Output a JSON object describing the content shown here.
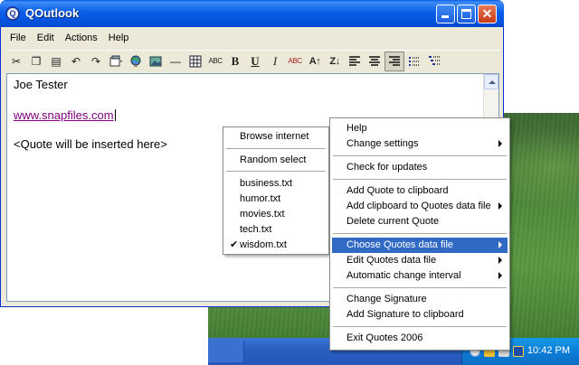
{
  "window": {
    "title": "QOutlook",
    "icon_glyph": "Q"
  },
  "menubar": [
    "File",
    "Edit",
    "Actions",
    "Help"
  ],
  "toolbar": {
    "icons": [
      "cut-icon",
      "copy-icon",
      "paste-icon",
      "undo-icon",
      "redo-icon",
      "insert-object-icon",
      "insert-globe-icon",
      "insert-picture-icon",
      "horizontal-line-icon",
      "table-icon",
      "spellcheck-icon",
      "bold-icon",
      "underline-icon",
      "italic-icon",
      "highlight-icon",
      "sort-ascending-icon",
      "sort-descending-icon",
      "align-left-icon",
      "align-center-icon",
      "align-right-icon",
      "bullet-list-icon",
      "numbered-list-icon"
    ],
    "glyphs": {
      "cut": "✂",
      "copy": "❐",
      "paste": "▤",
      "undo": "↶",
      "redo": "↷",
      "line": "—",
      "spell": "ABC",
      "bold": "B",
      "underline": "U",
      "italic": "I",
      "highlight": "ABC",
      "sort_asc": "A↑",
      "sort_desc": "Z↓"
    }
  },
  "editor": {
    "line1": "Joe Tester",
    "line2": "www.snapfiles.com",
    "line3": "<Quote will be inserted here>"
  },
  "main_menu": {
    "items": [
      {
        "label": "Help"
      },
      {
        "label": "Change settings",
        "submenu": true
      },
      {
        "label": "Check for updates"
      },
      {
        "label": "Add Quote to clipboard"
      },
      {
        "label": "Add clipboard to Quotes data file",
        "submenu": true
      },
      {
        "label": "Delete current Quote"
      },
      {
        "label": "Choose Quotes data file",
        "submenu": true,
        "highlighted": true
      },
      {
        "label": "Edit Quotes data file",
        "submenu": true
      },
      {
        "label": "Automatic change interval",
        "submenu": true
      },
      {
        "label": "Change Signature"
      },
      {
        "label": "Add Signature to clipboard"
      },
      {
        "label": "Exit Quotes 2006"
      }
    ]
  },
  "sub_menu": {
    "items": [
      {
        "label": "Browse internet"
      },
      {
        "label": "Random select"
      },
      {
        "label": "business.txt"
      },
      {
        "label": "humor.txt"
      },
      {
        "label": "movies.txt"
      },
      {
        "label": "tech.txt"
      },
      {
        "label": "wisdom.txt",
        "checked": true
      }
    ],
    "check_glyph": "✔"
  },
  "taskbar": {
    "clock": "10:42 PM"
  },
  "colors": {
    "title_blue": "#0a5de8",
    "menu_highlight": "#316ac5",
    "visited_link": "#800080"
  }
}
